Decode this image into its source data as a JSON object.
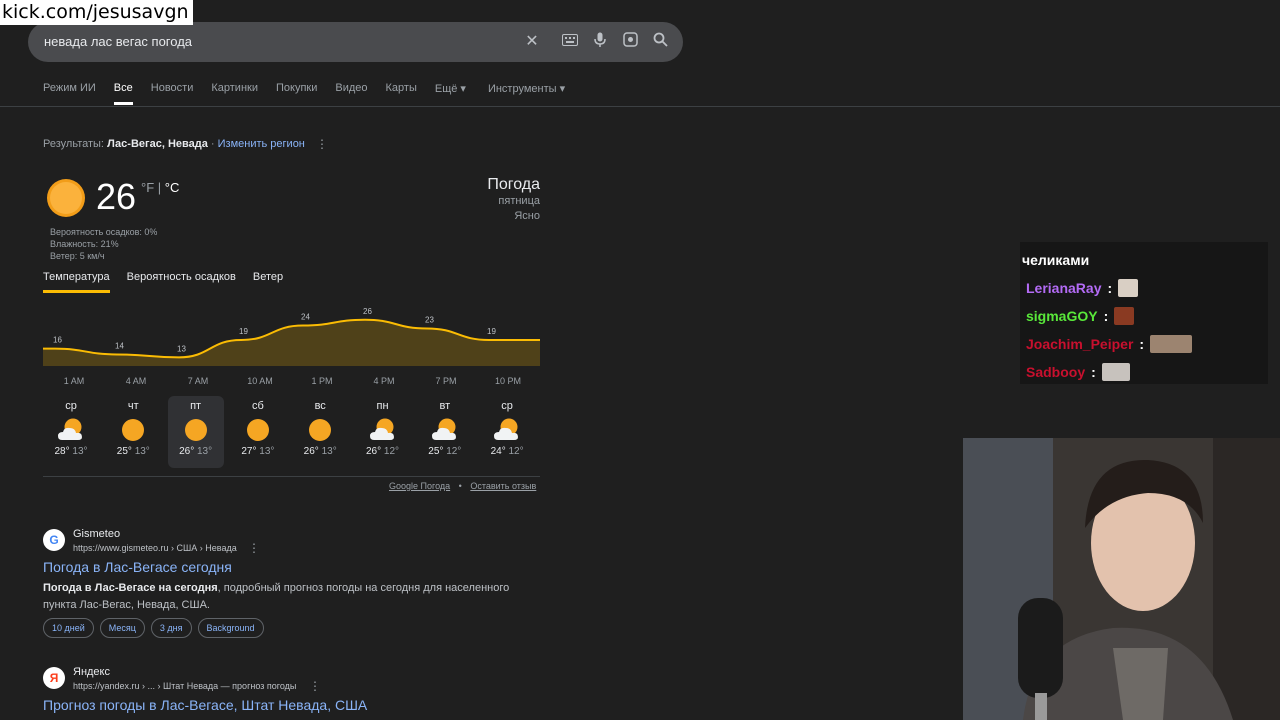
{
  "watermark": "kick.com/jesusavgn",
  "search": {
    "query": "невада лас вегас погода"
  },
  "tabs": [
    "Режим ИИ",
    "Все",
    "Новости",
    "Картинки",
    "Покупки",
    "Видео",
    "Карты",
    "Ещё ▾",
    "Инструменты ▾"
  ],
  "region": {
    "prefix": "Результаты:",
    "place": "Лас-Вегас, Невада",
    "sep": " · ",
    "change": "Изменить регион"
  },
  "weather": {
    "temp": "26",
    "unit_f": "°F",
    "unit_sep": "|",
    "unit_c": "°C",
    "precip": "Вероятность осадков: 0%",
    "humidity": "Влажность: 21%",
    "wind": "Ветер: 5 км/ч",
    "heading": "Погода",
    "day": "пятница",
    "condition": "Ясно",
    "metric_tabs": [
      "Температура",
      "Вероятность осадков",
      "Ветер"
    ],
    "footer_link1": "Google Погода",
    "footer_sep": "•",
    "footer_link2": "Оставить отзыв"
  },
  "chart_data": {
    "type": "area",
    "x": [
      "1 AM",
      "4 AM",
      "7 AM",
      "10 AM",
      "1 PM",
      "4 PM",
      "7 PM",
      "10 PM"
    ],
    "values": [
      16,
      14,
      13,
      19,
      24,
      26,
      23,
      19
    ],
    "title": "",
    "xlabel": "",
    "ylabel": "",
    "color": "#fbbc04"
  },
  "forecast": [
    {
      "day": "ср",
      "hi": "28°",
      "lo": "13°",
      "icon": "sun-cloud-icon"
    },
    {
      "day": "чт",
      "hi": "25°",
      "lo": "13°",
      "icon": "sun-icon"
    },
    {
      "day": "пт",
      "hi": "26°",
      "lo": "13°",
      "icon": "sun-icon"
    },
    {
      "day": "сб",
      "hi": "27°",
      "lo": "13°",
      "icon": "sun-icon"
    },
    {
      "day": "вс",
      "hi": "26°",
      "lo": "13°",
      "icon": "sun-icon"
    },
    {
      "day": "пн",
      "hi": "26°",
      "lo": "12°",
      "icon": "sun-cloud-icon"
    },
    {
      "day": "вт",
      "hi": "25°",
      "lo": "12°",
      "icon": "sun-cloud-icon"
    },
    {
      "day": "ср",
      "hi": "24°",
      "lo": "12°",
      "icon": "sun-cloud-icon"
    }
  ],
  "results": [
    {
      "favicon": "G",
      "site": "Gismeteo",
      "url": "https://www.gismeteo.ru › США › Невада",
      "title": "Погода в Лас-Вегасе сегодня",
      "snippet_bold": "Погода в Лас-Вегасе на сегодня",
      "snippet_rest": ", подробный прогноз погоды на сегодня для населенного пункта Лас-Вегас, Невада, США.",
      "chips": [
        "10 дней",
        "Месяц",
        "3 дня",
        "Background"
      ]
    },
    {
      "favicon": "Я",
      "site": "Яндекс",
      "url": "https://yandex.ru › ... › Штат Невада — прогноз погоды",
      "title": "Прогноз погоды в Лас-Вегасе, Штат Невада, США"
    }
  ],
  "chat": {
    "caption": "челиками",
    "messages": [
      {
        "user": "LerianaRay",
        "color": "#b36bf5"
      },
      {
        "user": "sigmaGOY",
        "color": "#59e83a"
      },
      {
        "user": "Joachim_Peiper",
        "color": "#c8102e"
      },
      {
        "user": "Sadbooy",
        "color": "#c8102e"
      }
    ],
    "colon": ":"
  }
}
